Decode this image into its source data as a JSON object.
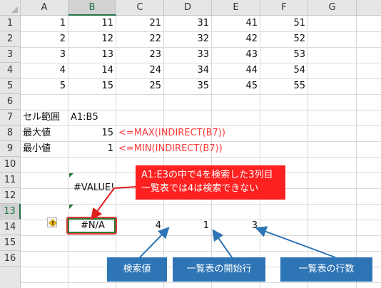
{
  "columns": [
    "A",
    "B",
    "C",
    "D",
    "E",
    "F",
    "G"
  ],
  "rows": [
    "1",
    "2",
    "3",
    "4",
    "5",
    "6",
    "7",
    "8",
    "9",
    "10",
    "11",
    "12",
    "13",
    "14",
    "15",
    "16"
  ],
  "table": [
    [
      "1",
      "11",
      "21",
      "31",
      "41",
      "51"
    ],
    [
      "2",
      "12",
      "22",
      "32",
      "42",
      "52"
    ],
    [
      "3",
      "13",
      "23",
      "33",
      "43",
      "53"
    ],
    [
      "4",
      "14",
      "24",
      "34",
      "44",
      "54"
    ],
    [
      "5",
      "15",
      "25",
      "35",
      "45",
      "55"
    ]
  ],
  "row7": {
    "label": "セル範囲",
    "value": "A1:B5"
  },
  "row8": {
    "label": "最大値",
    "value": "15",
    "formula": "<=MAX(INDIRECT(B7))"
  },
  "row9": {
    "label": "最小値",
    "value": "1",
    "formula": "<=MIN(INDIRECT(B7))"
  },
  "row11": {
    "value": "#VALUE!"
  },
  "row13": {
    "result": "#N/A",
    "search_value": "4",
    "start_row": "1",
    "row_count": "3"
  },
  "callouts": {
    "error_line1": "A1:E3の中で4を検索した3列目",
    "error_line2": "一覧表では4は検索できない",
    "search_value": "検索値",
    "start_row": "一覧表の開始行",
    "row_count": "一覧表の行数"
  },
  "colors": {
    "header_bg": "#e6e6e6",
    "selection": "#217346",
    "error_red": "#ff2020",
    "callout_blue": "#2e75b6",
    "formula_red": "#ff3a3a"
  }
}
